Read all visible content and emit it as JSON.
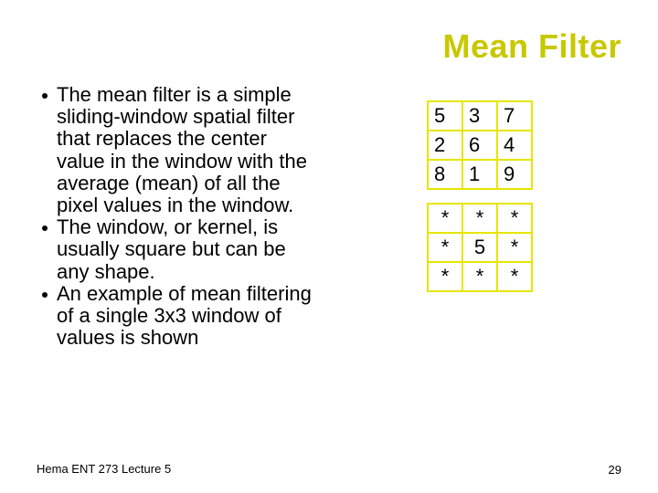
{
  "title": "Mean Filter",
  "bullets": [
    "The mean filter is a simple sliding-window spatial filter that replaces the center value in the window with the average (mean) of all the pixel values in the window.",
    "The window, or kernel, is usually square but can be any shape.",
    "An example of mean filtering of a single 3x3 window of values is shown"
  ],
  "chart_data": [
    {
      "type": "table",
      "title": "input-window",
      "values": [
        [
          5,
          3,
          7
        ],
        [
          2,
          6,
          4
        ],
        [
          8,
          1,
          9
        ]
      ]
    },
    {
      "type": "table",
      "title": "output-window",
      "values": [
        [
          "*",
          "*",
          "*"
        ],
        [
          "*",
          5,
          "*"
        ],
        [
          "*",
          "*",
          "*"
        ]
      ]
    }
  ],
  "footer": "Hema ENT 273 Lecture 5",
  "page_number": "29"
}
